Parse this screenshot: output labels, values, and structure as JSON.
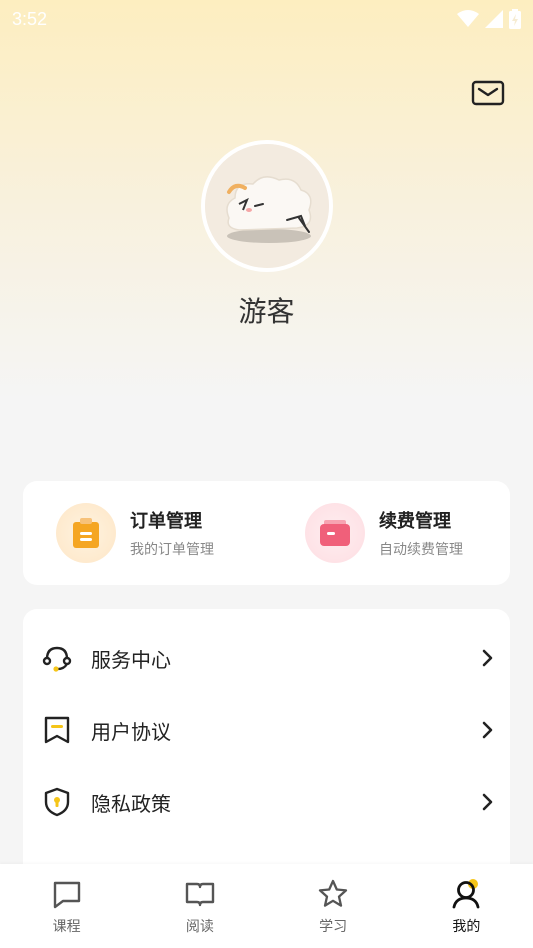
{
  "status_bar": {
    "time": "3:52"
  },
  "profile": {
    "username": "游客"
  },
  "quick_actions": [
    {
      "title": "订单管理",
      "subtitle": "我的订单管理",
      "icon": "clipboard-icon",
      "color": "#f5a623"
    },
    {
      "title": "续费管理",
      "subtitle": "自动续费管理",
      "icon": "wallet-icon",
      "color": "#f0607a"
    }
  ],
  "menu": [
    {
      "label": "服务中心",
      "icon": "headset-icon"
    },
    {
      "label": "用户协议",
      "icon": "agreement-icon"
    },
    {
      "label": "隐私政策",
      "icon": "shield-icon"
    }
  ],
  "tabbar": [
    {
      "label": "课程",
      "icon": "chat-icon",
      "active": false
    },
    {
      "label": "阅读",
      "icon": "book-icon",
      "active": false
    },
    {
      "label": "学习",
      "icon": "star-icon",
      "active": false
    },
    {
      "label": "我的",
      "icon": "user-icon",
      "active": true
    }
  ],
  "colors": {
    "accent": "#f5c518",
    "text_primary": "#222222",
    "text_secondary": "#888888"
  }
}
